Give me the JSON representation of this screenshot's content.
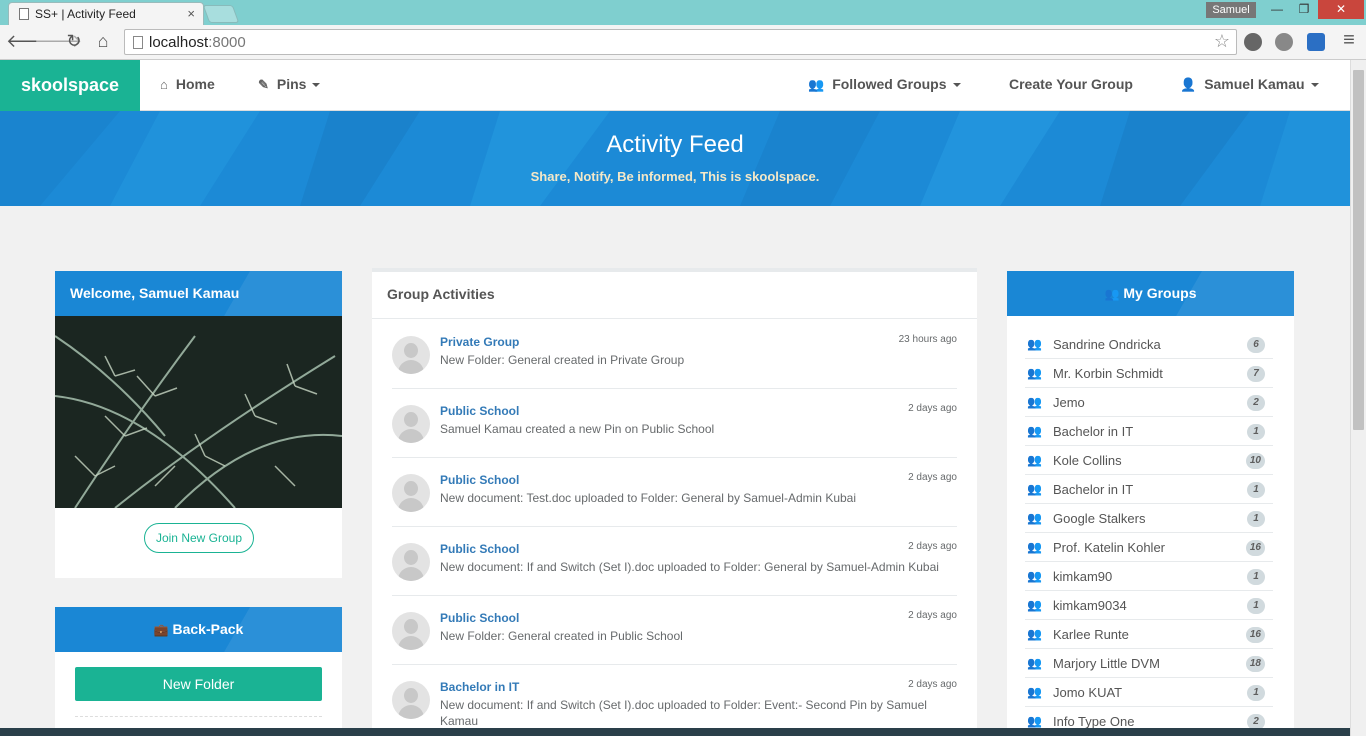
{
  "browser": {
    "tab_title": "SS+ | Activity Feed",
    "tab_close": "×",
    "profile_name": "Samuel",
    "window_min": "—",
    "window_max": "❐",
    "window_close": "✕",
    "url_host": "localhost",
    "url_port": ":8000",
    "back_icon": "🡐",
    "forward_icon": "🡒",
    "reload_icon": "↻",
    "home_icon": "⌂",
    "star_icon": "☆"
  },
  "navbar": {
    "brand": "skoolspace",
    "home": "Home",
    "home_icon": "⌂",
    "pins": "Pins",
    "pins_icon": "✎",
    "followed_groups": "Followed Groups",
    "followed_icon": "👥",
    "create_group": "Create Your Group",
    "user_name": "Samuel Kamau",
    "user_icon": "👤"
  },
  "hero": {
    "title": "Activity Feed",
    "subtitle": "Share, Notify, Be informed, This is skoolspace."
  },
  "welcome": {
    "heading": "Welcome, Samuel Kamau",
    "join_button": "Join New Group"
  },
  "backpack": {
    "heading": "Back-Pack",
    "heading_icon": "💼",
    "new_folder": "New Folder"
  },
  "activities": {
    "title": "Group Activities",
    "items": [
      {
        "group": "Private Group",
        "text": "New Folder: General created in Private Group",
        "time": "23 hours ago"
      },
      {
        "group": "Public School",
        "text": "Samuel Kamau created a new Pin on Public School",
        "time": "2 days ago"
      },
      {
        "group": "Public School",
        "text": "New document: Test.doc uploaded to Folder: General by Samuel-Admin Kubai",
        "time": "2 days ago"
      },
      {
        "group": "Public School",
        "text": "New document: If and Switch (Set I).doc uploaded to Folder: General by Samuel-Admin Kubai",
        "time": "2 days ago"
      },
      {
        "group": "Public School",
        "text": "New Folder: General created in Public School",
        "time": "2 days ago"
      },
      {
        "group": "Bachelor in IT",
        "text": "New document: If and Switch (Set I).doc uploaded to Folder: Event:- Second Pin by Samuel Kamau",
        "time": "2 days ago"
      }
    ]
  },
  "my_groups": {
    "heading": "My Groups",
    "heading_icon": "👥",
    "items": [
      {
        "name": "Sandrine Ondricka",
        "count": "6"
      },
      {
        "name": "Mr. Korbin Schmidt",
        "count": "7"
      },
      {
        "name": "Jemo",
        "count": "2"
      },
      {
        "name": "Bachelor in IT",
        "count": "1"
      },
      {
        "name": "Kole Collins",
        "count": "10"
      },
      {
        "name": "Bachelor in IT",
        "count": "1"
      },
      {
        "name": "Google Stalkers",
        "count": "1"
      },
      {
        "name": "Prof. Katelin Kohler",
        "count": "16"
      },
      {
        "name": "kimkam90",
        "count": "1"
      },
      {
        "name": "kimkam9034",
        "count": "1"
      },
      {
        "name": "Karlee Runte",
        "count": "16"
      },
      {
        "name": "Marjory Little DVM",
        "count": "18"
      },
      {
        "name": "Jomo KUAT",
        "count": "1"
      },
      {
        "name": "Info Type One",
        "count": "2"
      }
    ]
  },
  "colors": {
    "brand_green": "#1ab394",
    "primary_blue": "#1a87d5",
    "link_blue": "#337ab7"
  }
}
